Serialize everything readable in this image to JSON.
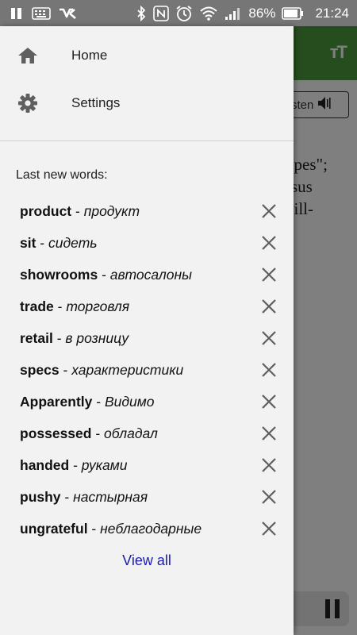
{
  "status_bar": {
    "battery": "86%",
    "time": "21:24",
    "icons": [
      "pause-icon",
      "keyboard-icon",
      "vk-icon",
      "bluetooth-icon",
      "nfc-icon",
      "alarm-icon",
      "wifi-icon",
      "signal-icon",
      "battery-icon"
    ]
  },
  "background": {
    "font_button": "ᴛT",
    "listen_label": "sten",
    "text_lines": [
      "opes\";",
      "rsus",
      "vill-"
    ],
    "toolbar_color": "#4a9a3c"
  },
  "drawer": {
    "nav": [
      {
        "label": "Home",
        "icon": "home-icon"
      },
      {
        "label": "Settings",
        "icon": "gear-icon"
      }
    ],
    "section_title": "Last new words:",
    "words": [
      {
        "en": "product",
        "sep": " - ",
        "ru": "продукт"
      },
      {
        "en": "sit",
        "sep": " - ",
        "ru": "сидеть"
      },
      {
        "en": "showrooms",
        "sep": " - ",
        "ru": "автосалоны"
      },
      {
        "en": "trade",
        "sep": " - ",
        "ru": "торговля"
      },
      {
        "en": "retail",
        "sep": " - ",
        "ru": "в розницу"
      },
      {
        "en": "specs",
        "sep": " - ",
        "ru": "характеристики"
      },
      {
        "en": "Apparently",
        "sep": " - ",
        "ru": "Видимо"
      },
      {
        "en": "possessed",
        "sep": " - ",
        "ru": "обладал"
      },
      {
        "en": "handed",
        "sep": " - ",
        "ru": "руками"
      },
      {
        "en": "pushy",
        "sep": " - ",
        "ru": "настырная"
      },
      {
        "en": "ungrateful",
        "sep": " - ",
        "ru": "неблагодарные"
      }
    ],
    "view_all": "View all",
    "link_color": "#1a1ab8"
  }
}
